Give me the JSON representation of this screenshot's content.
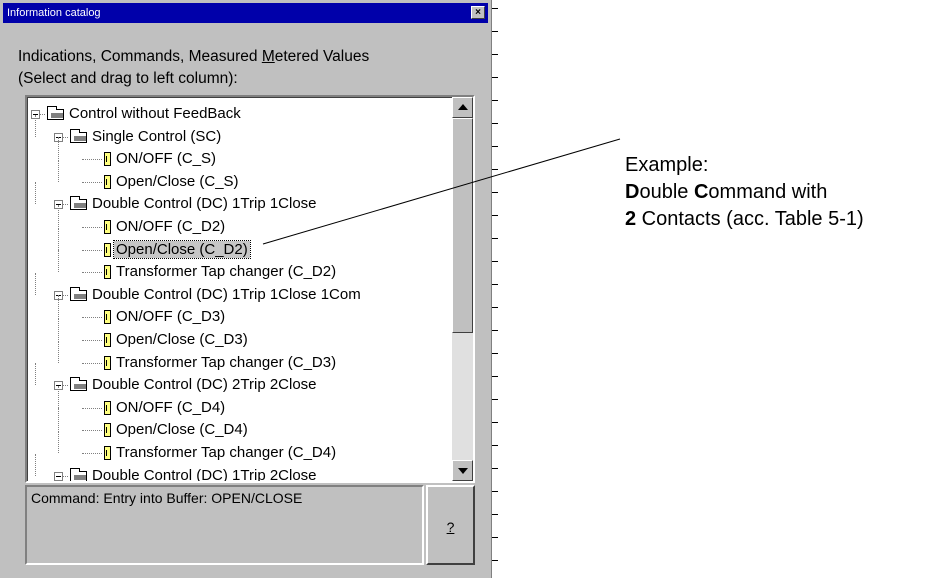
{
  "window": {
    "title": "Information catalog",
    "close_glyph": "×"
  },
  "heading": {
    "line1_before": "Indications, Commands, Measured ",
    "line1_underlined": "M",
    "line1_after": "etered Values",
    "line2": "(Select and drag to left column):"
  },
  "tree": {
    "rows": [
      {
        "label": "Control without FeedBack",
        "level": 0,
        "type": "folder"
      },
      {
        "label": "Single Control (SC)",
        "level": 1,
        "type": "folder"
      },
      {
        "label": "ON/OFF (C_S)",
        "level": 2,
        "type": "leaf"
      },
      {
        "label": "Open/Close (C_S)",
        "level": 2,
        "type": "leaf"
      },
      {
        "label": "Double Control (DC) 1Trip 1Close",
        "level": 1,
        "type": "folder"
      },
      {
        "label": "ON/OFF (C_D2)",
        "level": 2,
        "type": "leaf"
      },
      {
        "label": "Open/Close (C_D2)",
        "level": 2,
        "type": "leaf",
        "selected": true
      },
      {
        "label": "Transformer Tap changer (C_D2)",
        "level": 2,
        "type": "leaf"
      },
      {
        "label": "Double Control (DC) 1Trip 1Close 1Com",
        "level": 1,
        "type": "folder"
      },
      {
        "label": "ON/OFF (C_D3)",
        "level": 2,
        "type": "leaf"
      },
      {
        "label": "Open/Close (C_D3)",
        "level": 2,
        "type": "leaf"
      },
      {
        "label": "Transformer Tap changer (C_D3)",
        "level": 2,
        "type": "leaf"
      },
      {
        "label": "Double Control (DC) 2Trip 2Close",
        "level": 1,
        "type": "folder"
      },
      {
        "label": "ON/OFF (C_D4)",
        "level": 2,
        "type": "leaf"
      },
      {
        "label": "Open/Close (C_D4)",
        "level": 2,
        "type": "leaf"
      },
      {
        "label": "Transformer Tap changer (C_D4)",
        "level": 2,
        "type": "leaf"
      },
      {
        "label": "Double Control (DC) 1Trip 2Close",
        "level": 1,
        "type": "folder"
      }
    ]
  },
  "status": {
    "text": "Command: Entry into Buffer: OPEN/CLOSE"
  },
  "help_button": {
    "label": "?"
  },
  "annotation": {
    "line1": "Example:",
    "line2_b1": "D",
    "line2_t1": "ouble ",
    "line2_b2": "C",
    "line2_t2": "ommand with",
    "line3_b": "2",
    "line3_t": " Contacts (acc. Table 5-1)"
  }
}
